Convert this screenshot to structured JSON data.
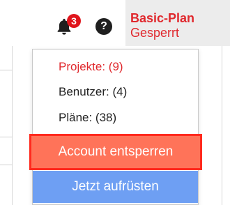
{
  "header": {
    "notifications": {
      "icon": "bell-icon",
      "count": "3"
    },
    "help": {
      "icon": "question-icon",
      "label": "?"
    },
    "plan": {
      "name": "Basic-Plan",
      "status": "Gesperrt"
    }
  },
  "dropdown": {
    "items": [
      {
        "label": "Projekte: (9)",
        "active": true
      },
      {
        "label": "Benutzer: (4)",
        "active": false
      },
      {
        "label": "Pläne: (38)",
        "active": false
      }
    ],
    "unlock_label": "Account entsperren",
    "upgrade_label": "Jetzt aufrüsten"
  },
  "colors": {
    "accent_red": "#e0282d",
    "badge_red": "#e0151c",
    "unlock_bg": "#ff7359",
    "unlock_border": "#ff2a1e",
    "upgrade_bg": "#6e9ff3"
  }
}
